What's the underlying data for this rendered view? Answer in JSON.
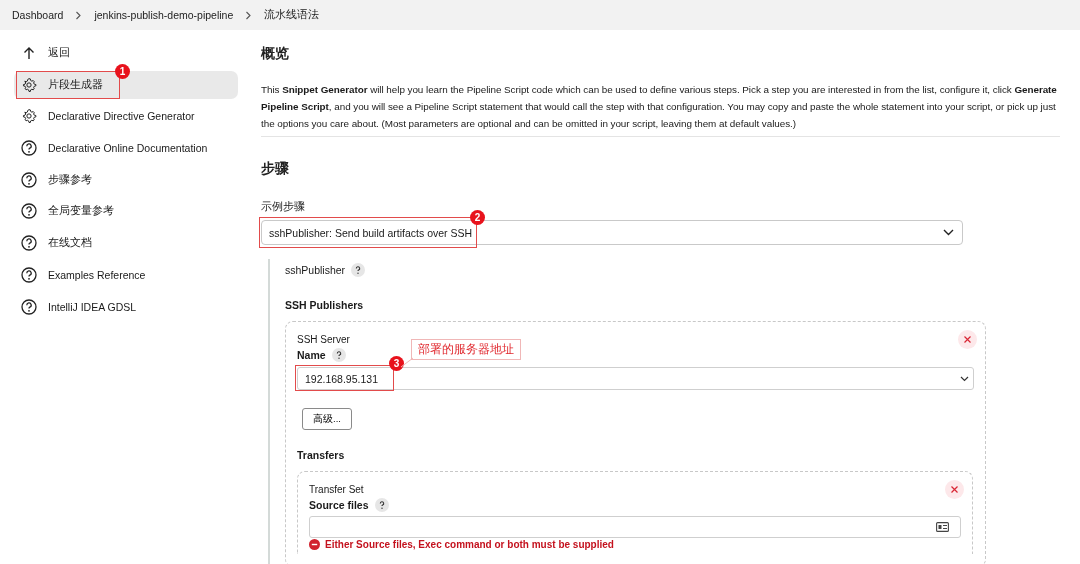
{
  "breadcrumb": [
    "Dashboard",
    "jenkins-publish-demo-pipeline",
    "流水线语法"
  ],
  "sidebar": {
    "items": [
      {
        "label": "返回",
        "kind": "back",
        "selected": false
      },
      {
        "label": "片段生成器",
        "kind": "generator",
        "selected": true,
        "marker": "1"
      },
      {
        "label": "Declarative Directive Generator",
        "kind": "generator",
        "selected": false
      },
      {
        "label": "Declarative Online Documentation",
        "kind": "help",
        "selected": false
      },
      {
        "label": "步骤参考",
        "kind": "help",
        "selected": false
      },
      {
        "label": "全局变量参考",
        "kind": "help",
        "selected": false
      },
      {
        "label": "在线文档",
        "kind": "help",
        "selected": false
      },
      {
        "label": "Examples Reference",
        "kind": "help",
        "selected": false
      },
      {
        "label": "IntelliJ IDEA GDSL",
        "kind": "help",
        "selected": false
      }
    ]
  },
  "overview": {
    "title": "概览",
    "description": "This **Snippet Generator** will help you learn the Pipeline Script code which can be used to define various steps. Pick a step you are interested in from the list, configure it, click **Generate Pipeline Script**, and you will see a Pipeline Script statement that would call the step with that configuration. You may copy and paste the whole statement into your script, or pick up just the options you care about. (Most parameters are optional and can be omitted in your script, leaving them at default values.)"
  },
  "steps": {
    "title": "步骤",
    "field_label": "示例步骤",
    "value": "sshPublisher: Send build artifacts over SSH",
    "marker": "2"
  },
  "publisher": {
    "name": "sshPublisher",
    "section": "SSH Publishers",
    "server": {
      "caption": "SSH Server",
      "name_label": "Name",
      "value": "192.168.95.131",
      "marker": "3",
      "callout": "部署的服务器地址",
      "advanced_button": "高级..."
    },
    "transfers": {
      "title": "Transfers",
      "set_caption": "Transfer Set",
      "source_label": "Source files",
      "error": "Either Source files, Exec command or both must be supplied"
    }
  }
}
